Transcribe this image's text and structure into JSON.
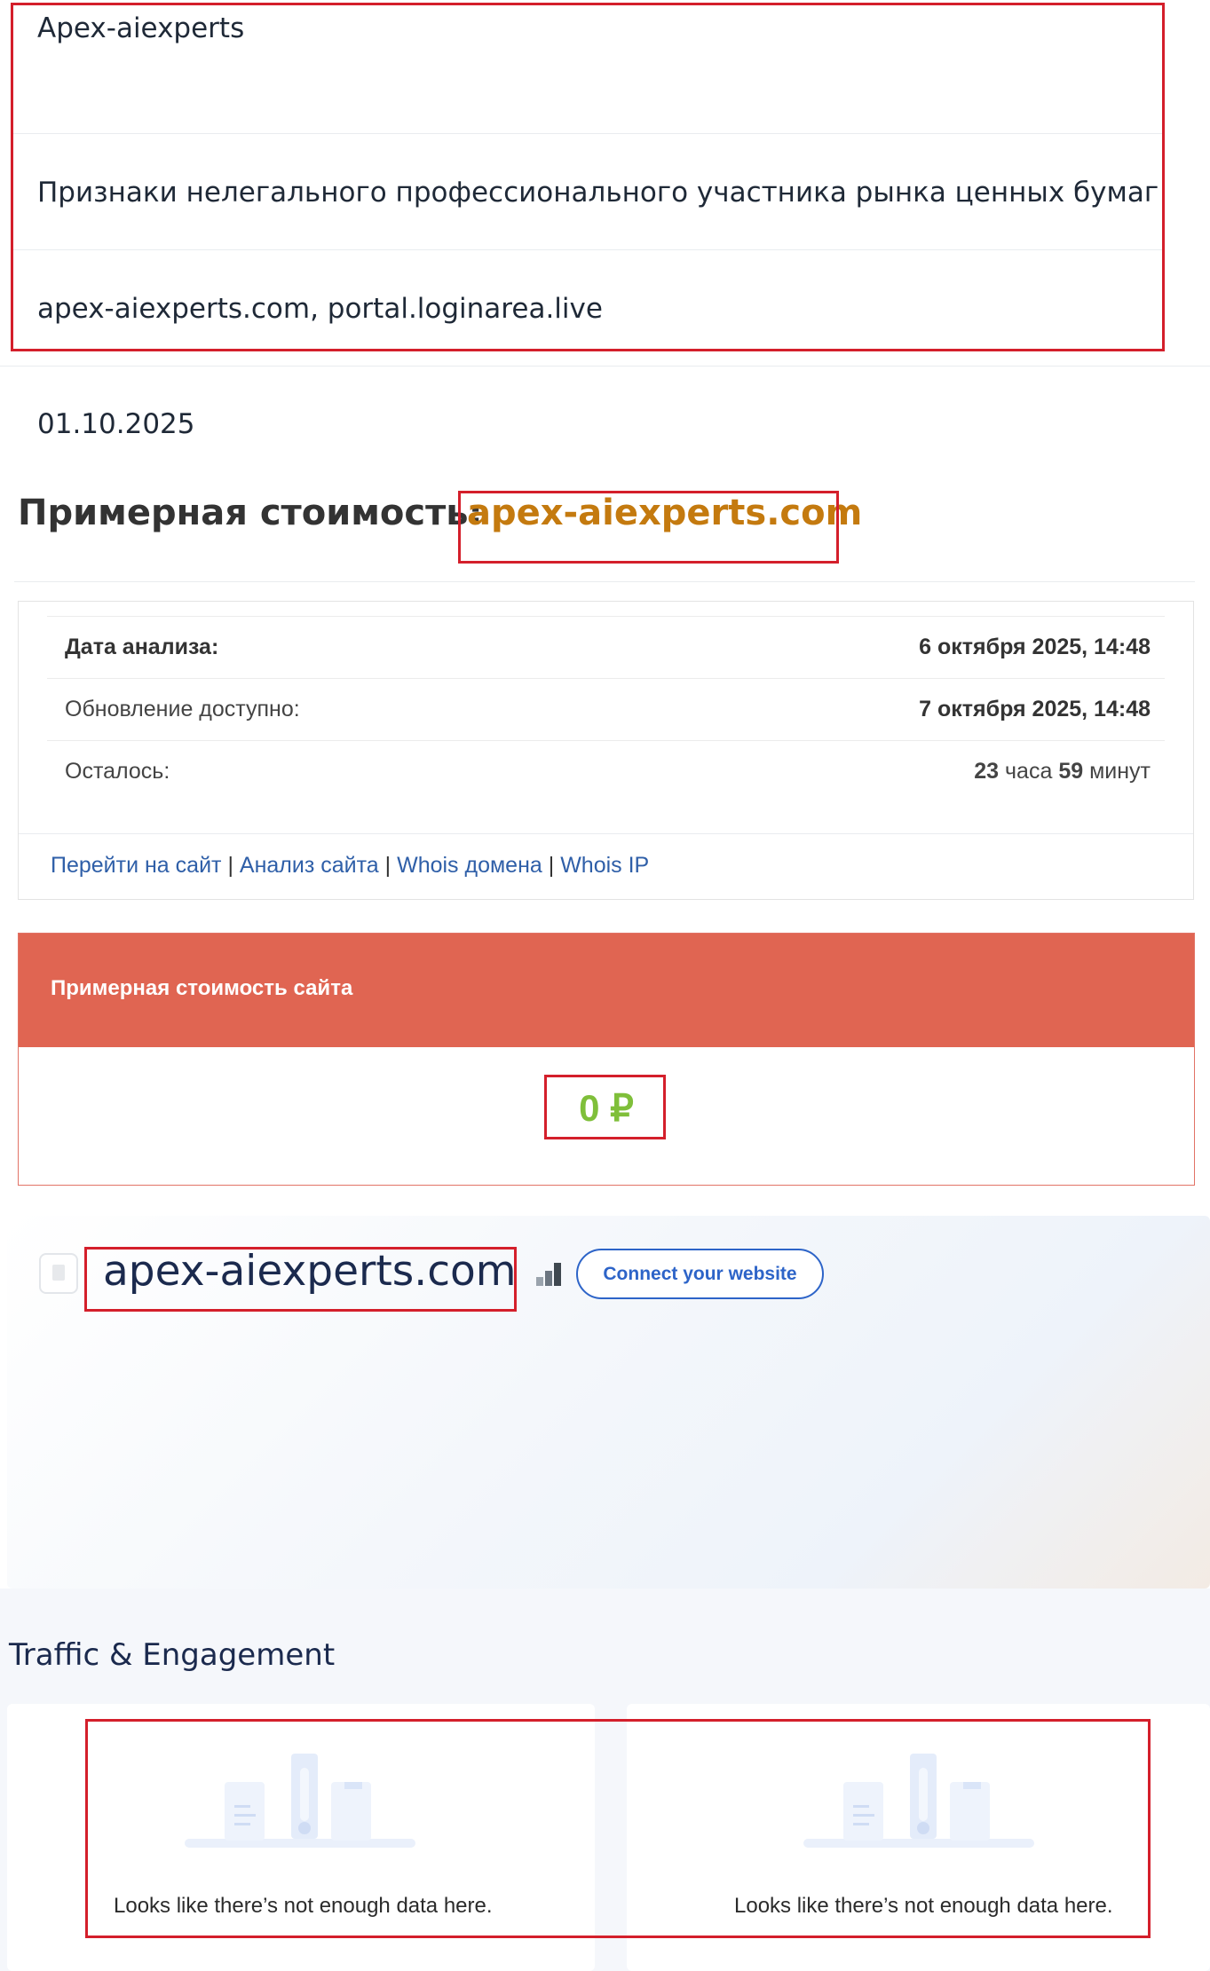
{
  "info": {
    "name": "Apex-aiexperts",
    "reason": "Признаки нелегального профессионального участника рынка ценных бумаг",
    "domains": "apex-aiexperts.com, portal.loginarea.live",
    "date": "01.10.2025"
  },
  "heading": {
    "label": "Примерная стоимость:",
    "domain": "apex-aiexperts.com"
  },
  "analysis_table": {
    "rows": [
      {
        "label": "Дата анализа:",
        "value": "6 октября 2025, 14:48"
      },
      {
        "label": "Обновление доступно:",
        "value": "7 октября 2025, 14:48"
      },
      {
        "label": "Осталось:",
        "value_hours": "23",
        "value_hours_unit": "часа",
        "value_minutes": "59",
        "value_minutes_unit": "минут"
      }
    ],
    "links": [
      "Перейти на сайт",
      "Анализ сайта",
      "Whois домена",
      "Whois IP"
    ],
    "separator": "|"
  },
  "cost_card": {
    "title": "Примерная стоимость сайта",
    "value": "0 ₽"
  },
  "site_card": {
    "domain": "apex-aiexperts.com",
    "connect_label": "Connect your website",
    "icons": [
      "file-icon",
      "rank-bars-icon"
    ]
  },
  "traffic": {
    "title": "Traffic & Engagement",
    "cards": [
      {
        "message": "Looks like there’s not enough data here."
      },
      {
        "message": "Looks like there’s not enough data here."
      }
    ]
  },
  "colors": {
    "highlight_box": "#d41f2b",
    "cost_header": "#e06552",
    "cost_value": "#7fbf3a",
    "heading_domain": "#c47a0f",
    "link": "#2f5fa8",
    "brand_blue": "#2d64c8"
  }
}
